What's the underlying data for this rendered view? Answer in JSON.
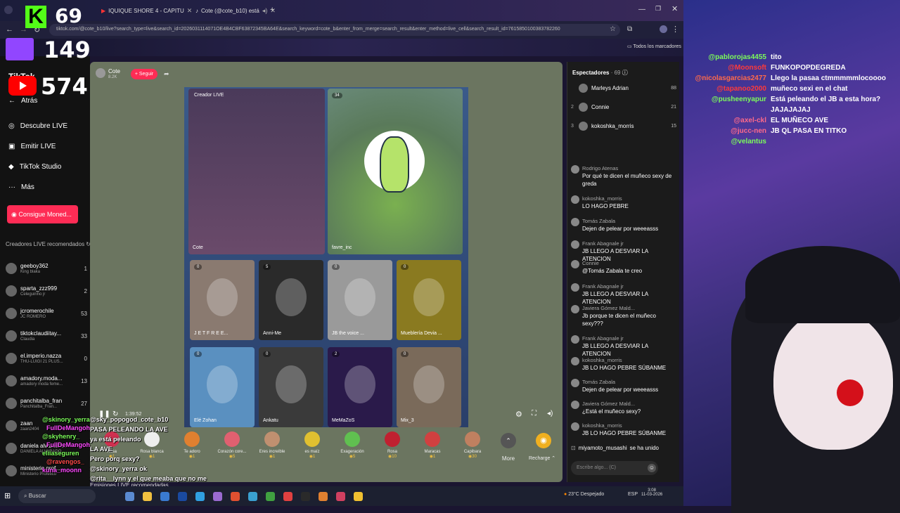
{
  "browser": {
    "tabs": [
      {
        "label": "IQUIQUE SHORE 4 - CAPITU"
      },
      {
        "label": "Cote (@cote_b10) está"
      }
    ],
    "url": "tiktok.com/@cote_b10/live?search_type=live&search_id=2026031114071OE4B4CBF63872345BA64E&search_keyword=cote_b&enter_from_merge=search_result&enter_method=live_cell&search_result_id=7615850100383782260",
    "bookmarks_label": "Todos los marcadores"
  },
  "overlay_stats": {
    "kick": "69",
    "twitch": "149",
    "youtube": "574"
  },
  "sidebar": {
    "logo": "TikTok",
    "back": "Atrás",
    "nav": [
      {
        "icon": "compass-icon",
        "label": "Descubre LIVE"
      },
      {
        "icon": "broadcast-icon",
        "label": "Emitir LIVE"
      },
      {
        "icon": "studio-icon",
        "label": "TikTok Studio"
      },
      {
        "icon": "more-icon",
        "label": "Más"
      }
    ],
    "coins_button": "Consigue Moned...",
    "recommended_title": "Creadores LIVE recomendados",
    "creators": [
      {
        "name": "geeboy362",
        "sub": "King blaka",
        "count": "1"
      },
      {
        "name": "sparta_zzz999",
        "sub": "Celeguinho jr",
        "count": "2"
      },
      {
        "name": "jcromerochile",
        "sub": "JC ROMERO",
        "count": "53"
      },
      {
        "name": "tiktokclaudiitay...",
        "sub": "Claudia",
        "count": "33"
      },
      {
        "name": "el.imperio.nazza",
        "sub": "THU-LUIGI 21 PLUS...",
        "count": "0"
      },
      {
        "name": "amadory.moda...",
        "sub": "amadory moda feme...",
        "count": "13"
      },
      {
        "name": "panchitalba_fran",
        "sub": "Panchitalba_Fran...",
        "count": "27"
      },
      {
        "name": "zaan",
        "sub": "zaan2404",
        "count": ""
      },
      {
        "name": "daniela alvarado...",
        "sub": "DANIELA ALVARADO",
        "count": ""
      },
      {
        "name": "ministerio.prof...",
        "sub": "Ministerio Profetico",
        "count": ""
      }
    ],
    "footer": "Emisiones LIVE recomendadas"
  },
  "live": {
    "host_name": "Cote",
    "host_likes": "8.2K",
    "follow_label": "+ Seguir",
    "creator_tag": "Creador LIVE",
    "main_left_label": "Cote",
    "main_right_label": "favre_inc",
    "main_right_badge": "34",
    "guests": [
      {
        "label": "J E T F R E E...",
        "badge": "0",
        "bg": "#8a7a70"
      },
      {
        "label": "Anni-Me",
        "badge": "5",
        "bg": "#2a2a2a"
      },
      {
        "label": "JB the voice ...",
        "badge": "0",
        "bg": "#9a9a9a"
      },
      {
        "label": "Mueblería Devia ...",
        "badge": "0",
        "bg": "#8a7a20"
      },
      {
        "label": "Elé Zohan",
        "badge": "0",
        "bg": "#5a90c0"
      },
      {
        "label": "Ankatu",
        "badge": "0",
        "bg": "#3a3a3a"
      },
      {
        "label": "MeMaZoS",
        "badge": "2",
        "bg": "#2a1a4a"
      },
      {
        "label": "Mix_3",
        "badge": "0",
        "bg": "#7a6a5a"
      }
    ],
    "timer": "1:39:52",
    "gifts": [
      {
        "name": "Rosa",
        "cost": "1",
        "color": "#d03050"
      },
      {
        "name": "Rosa blanca",
        "cost": "1",
        "color": "#eeeeee"
      },
      {
        "name": "Te adoro",
        "cost": "1",
        "color": "#e08030"
      },
      {
        "name": "Corazón core...",
        "cost": "5",
        "color": "#e06070"
      },
      {
        "name": "Eres increíble",
        "cost": "1",
        "color": "#c09070"
      },
      {
        "name": "es maíz",
        "cost": "1",
        "color": "#e0c030"
      },
      {
        "name": "Exageración",
        "cost": "5",
        "color": "#60c050"
      },
      {
        "name": "Rosa",
        "cost": "10",
        "color": "#c02030"
      },
      {
        "name": "Maracas",
        "cost": "1",
        "color": "#d04040"
      },
      {
        "name": "Capibara",
        "cost": "30",
        "color": "#c08060"
      }
    ],
    "more_label": "More",
    "recharge_label": "Recharge"
  },
  "chat": {
    "viewers_title": "Espectadores",
    "viewers_count": "69",
    "top_viewers": [
      {
        "rank": "",
        "name": "Marleys Adrian",
        "count": "88"
      },
      {
        "rank": "2",
        "name": "Connie",
        "count": "21"
      },
      {
        "rank": "3",
        "name": "kokoshka_morris",
        "count": "15"
      }
    ],
    "messages": [
      {
        "user": "Rodrigo Atenas",
        "text": "Por qué te dicen el muñeco sexy de greda"
      },
      {
        "user": "kokoshka_morris",
        "text": "LO HAGO PEBRE"
      },
      {
        "user": "Tomás Zabala",
        "text": "Dejen de pelear por weeeasss"
      },
      {
        "user": "Frank Abagnale jr",
        "text": "JB LLEGO A DESVIAR LA ATENCION"
      },
      {
        "user": "Connie",
        "text": "@Tomás Zabala te creo"
      },
      {
        "user": "Frank Abagnale jr",
        "text": "JB LLEGO A DESVIAR LA ATENCION"
      },
      {
        "user": "Javiera Gómez Mald...",
        "text": "Jb porque te dicen el muñeco sexy???"
      },
      {
        "user": "Frank Abagnale jr",
        "text": "JB LLEGO A DESVIAR LA ATENCION"
      },
      {
        "user": "kokoshka_morris",
        "text": "JB LO HAGO PEBRE SÚBANME"
      },
      {
        "user": "Tomás Zabala",
        "text": "Dejen de pelear por weeeasss"
      },
      {
        "user": "Javiera Gómez Mald...",
        "text": "¿Está el muñeco sexy?"
      },
      {
        "user": "kokoshka_morris",
        "text": "JB LO HAGO PEBRE SÚBANME"
      }
    ],
    "join_user": "miyamoto_musashi",
    "join_text": "se ha unido",
    "input_placeholder": "Escribe algo... (C)"
  },
  "stream_chat_right": [
    {
      "user": "@pablorojas4455",
      "text": "tito",
      "color": "#7cfc5a"
    },
    {
      "user": "@Moonsoft",
      "text": "FUNKOPOPDEGREDA",
      "color": "#ff3a3a"
    },
    {
      "user": "@nicolasgarcias2477",
      "text": "Llego la pasaa ctmmmmmlocoooo",
      "color": "#ff6a4a"
    },
    {
      "user": "@tapanoo2000",
      "text": "muñeco sexi en el chat",
      "color": "#ff3a3a"
    },
    {
      "user": "@pusheenyapur",
      "text": "Está peleando el JB a esta hora?",
      "color": "#7cfc5a"
    },
    {
      "user": "",
      "text": "JAJAJAJAJ",
      "color": "#7cfc5a"
    },
    {
      "user": "@axel-ckl",
      "text": "EL MUÑECO AVE",
      "color": "#ff6a8a"
    },
    {
      "user": "@jucc-nen",
      "text": "JB QL PASA EN TITKO",
      "color": "#ff6a8a"
    },
    {
      "user": "@velantus",
      "text": "",
      "color": "#7cfc5a"
    }
  ],
  "stream_chat_bottom": [
    "@sky_popogod_cote_b10",
    "PASA PELEANDO LA AVE",
    "ya está peleando",
    "LA AVE",
    "Pero porq sexy?",
    "@skinory_yerra ok",
    "@rita__lynn y el que meaba que no me"
  ],
  "stream_chat_bottom_users": [
    {
      "text": "@skinory_yerra",
      "color": "#7cfc5a"
    },
    {
      "text": "FullDeMangoh",
      "color": "#ff4aff"
    },
    {
      "text": "@skyhenry_",
      "color": "#7cfc5a"
    },
    {
      "text": "FullDeMangoh",
      "color": "#ff4aff"
    },
    {
      "text": "eliiaseguren",
      "color": "#7cfc5a"
    },
    {
      "text": "@ravengos_",
      "color": "#ff4a4a"
    },
    {
      "text": "kuna_moonn",
      "color": "#ff4aff"
    }
  ],
  "taskbar": {
    "search": "Buscar",
    "weather": "23°C Despejado",
    "lang": "ESP",
    "time": "3:08",
    "date": "11-03-2026"
  }
}
